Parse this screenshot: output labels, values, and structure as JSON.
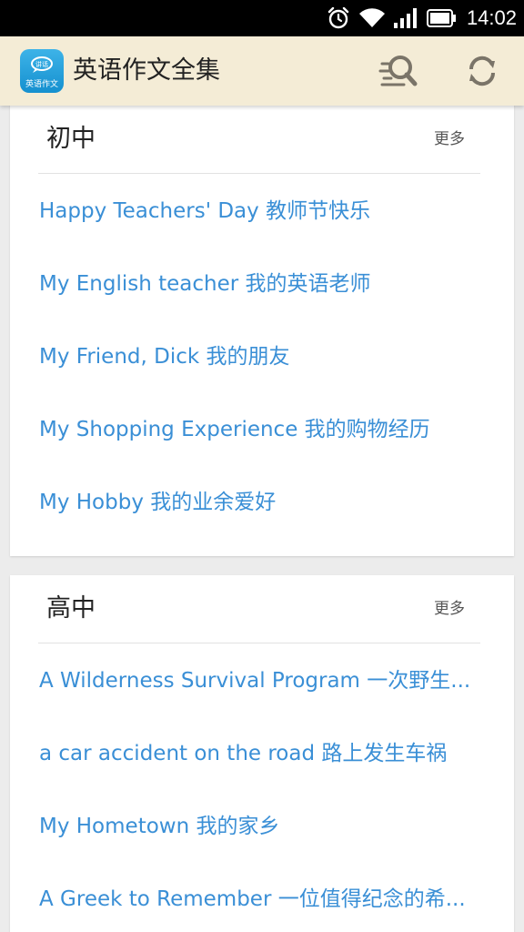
{
  "status_bar": {
    "time": "14:02",
    "icons": [
      "alarm-icon",
      "wifi-icon",
      "signal-icon",
      "battery-icon"
    ]
  },
  "app_bar": {
    "title": "英语作文全集",
    "logo_text": "英语作文",
    "logo_badge": "讲话",
    "actions": [
      "search-icon",
      "refresh-icon"
    ]
  },
  "colors": {
    "app_bar_bg": "#f4ecd6",
    "link": "#3a8fd6",
    "logo": "#1c9bdc",
    "page_bg": "#ececec"
  },
  "sections": [
    {
      "title": "初中",
      "more_label": "更多",
      "items": [
        "Happy Teachers' Day 教师节快乐",
        "My English teacher 我的英语老师",
        "My Friend, Dick 我的朋友",
        "My Shopping Experience 我的购物经历",
        "My Hobby 我的业余爱好"
      ]
    },
    {
      "title": "高中",
      "more_label": "更多",
      "items": [
        "A Wilderness Survival Program 一次野生...",
        "a car accident on the road 路上发生车祸",
        "My Hometown 我的家乡",
        "A Greek to Remember 一位值得纪念的希..."
      ]
    }
  ]
}
